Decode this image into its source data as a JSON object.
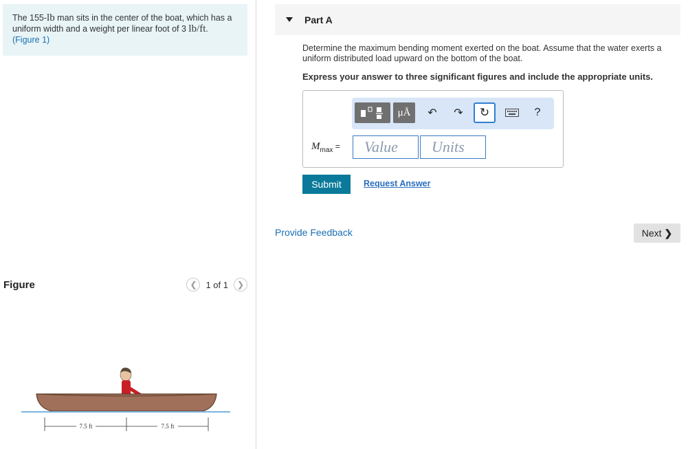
{
  "problem": {
    "text_a": "The 155-",
    "unit_lb": "lb",
    "text_b": " man sits in the center of the boat, which has a uniform width and a weight per linear foot of 3 ",
    "unit_lbft": "lb/ft",
    "text_c": ".",
    "figure_link": "(Figure 1)"
  },
  "figure": {
    "title": "Figure",
    "pager": "1 of 1",
    "dim_left": "7.5 ft",
    "dim_right": "7.5 ft"
  },
  "part": {
    "title": "Part A",
    "question": "Determine the maximum bending moment exerted on the boat. Assume that the water exerts a uniform distributed load upward on the bottom of the boat.",
    "instruction": "Express your answer to three significant figures and include the appropriate units."
  },
  "answer": {
    "label_var": "M",
    "label_sub": "max",
    "label_eq": " =",
    "value_placeholder": "Value",
    "units_placeholder": "Units",
    "toolbar": {
      "units_symbol": "μÅ",
      "help": "?"
    }
  },
  "actions": {
    "submit": "Submit",
    "request_answer": "Request Answer",
    "feedback": "Provide Feedback",
    "next": "Next"
  },
  "colors": {
    "accent": "#0b7a9a",
    "link": "#1a6fb5",
    "toolbar_bg": "#d8e6f7",
    "problem_bg": "#e8f4f6",
    "boat": "#a0705a"
  }
}
